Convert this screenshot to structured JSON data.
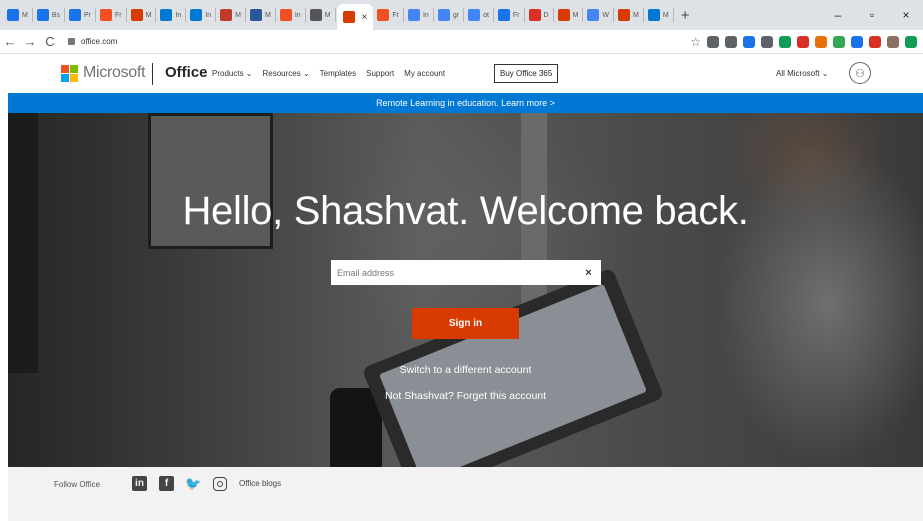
{
  "browser": {
    "tabs": [
      {
        "title": "M",
        "color": "#1a73e8"
      },
      {
        "title": "Bs",
        "color": "#1a73e8"
      },
      {
        "title": "Pr",
        "color": "#1a73e8"
      },
      {
        "title": "Fr",
        "color": "#f25022"
      },
      {
        "title": "M",
        "color": "#d83b01"
      },
      {
        "title": "In",
        "color": "#0078d4"
      },
      {
        "title": "In",
        "color": "#0078d4"
      },
      {
        "title": "M",
        "color": "#c0392b"
      },
      {
        "title": "M",
        "color": "#2b579a"
      },
      {
        "title": "In",
        "color": "#f25022"
      },
      {
        "title": "M",
        "color": "#555555"
      }
    ],
    "active_tab_close": "×",
    "tabs_after": [
      {
        "title": "Fr",
        "color": "#f25022"
      },
      {
        "title": "In",
        "color": "#4285f4"
      },
      {
        "title": "gr",
        "color": "#4285f4"
      },
      {
        "title": "ot",
        "color": "#4285f4"
      },
      {
        "title": "Fr",
        "color": "#1a73e8"
      },
      {
        "title": "D",
        "color": "#d93025"
      },
      {
        "title": "M",
        "color": "#d83b01"
      },
      {
        "title": "W",
        "color": "#4285f4"
      },
      {
        "title": "M",
        "color": "#d83b01"
      },
      {
        "title": "M",
        "color": "#0078d4"
      }
    ],
    "new_tab": "+",
    "window_controls": {
      "minimize": "–",
      "maximize": "▫",
      "close": "×"
    },
    "url": "office.com",
    "back": "←",
    "forward": "→",
    "reload": "C",
    "bookmark_star": "☆",
    "extension_colors": [
      "#5f6368",
      "#5f6368",
      "#1a73e8",
      "#5f6368",
      "#0f9d58",
      "#d93025",
      "#e8710a",
      "#34a853",
      "#1a73e8",
      "#d93025",
      "#8d6e63",
      "#0f9d58"
    ]
  },
  "header": {
    "logo_colors": [
      "#f25022",
      "#7fba00",
      "#00a4ef",
      "#ffb900"
    ],
    "brand": "Microsoft",
    "product": "Office",
    "nav": [
      {
        "label": "Products ⌄"
      },
      {
        "label": "Resources ⌄"
      },
      {
        "label": "Templates"
      },
      {
        "label": "Support"
      },
      {
        "label": "My account"
      }
    ],
    "buy_button": "Buy Office 365",
    "all_microsoft": "All Microsoft ⌄",
    "avatar_glyph": "⚇"
  },
  "banner": {
    "text": "Remote Learning in education. Learn more >"
  },
  "hero": {
    "headline": "Hello, Shashvat. Welcome back.",
    "email_placeholder": "Email address",
    "clear_glyph": "×",
    "sign_in": "Sign in",
    "switch_account": "Switch to a different account",
    "not_user": "Not Shashvat?",
    "forget_account": "Forget this account"
  },
  "footer": {
    "follow_label": "Follow Office",
    "linkedin": "in",
    "facebook": "f",
    "twitter": "🐦",
    "blogs": "Office blogs"
  }
}
